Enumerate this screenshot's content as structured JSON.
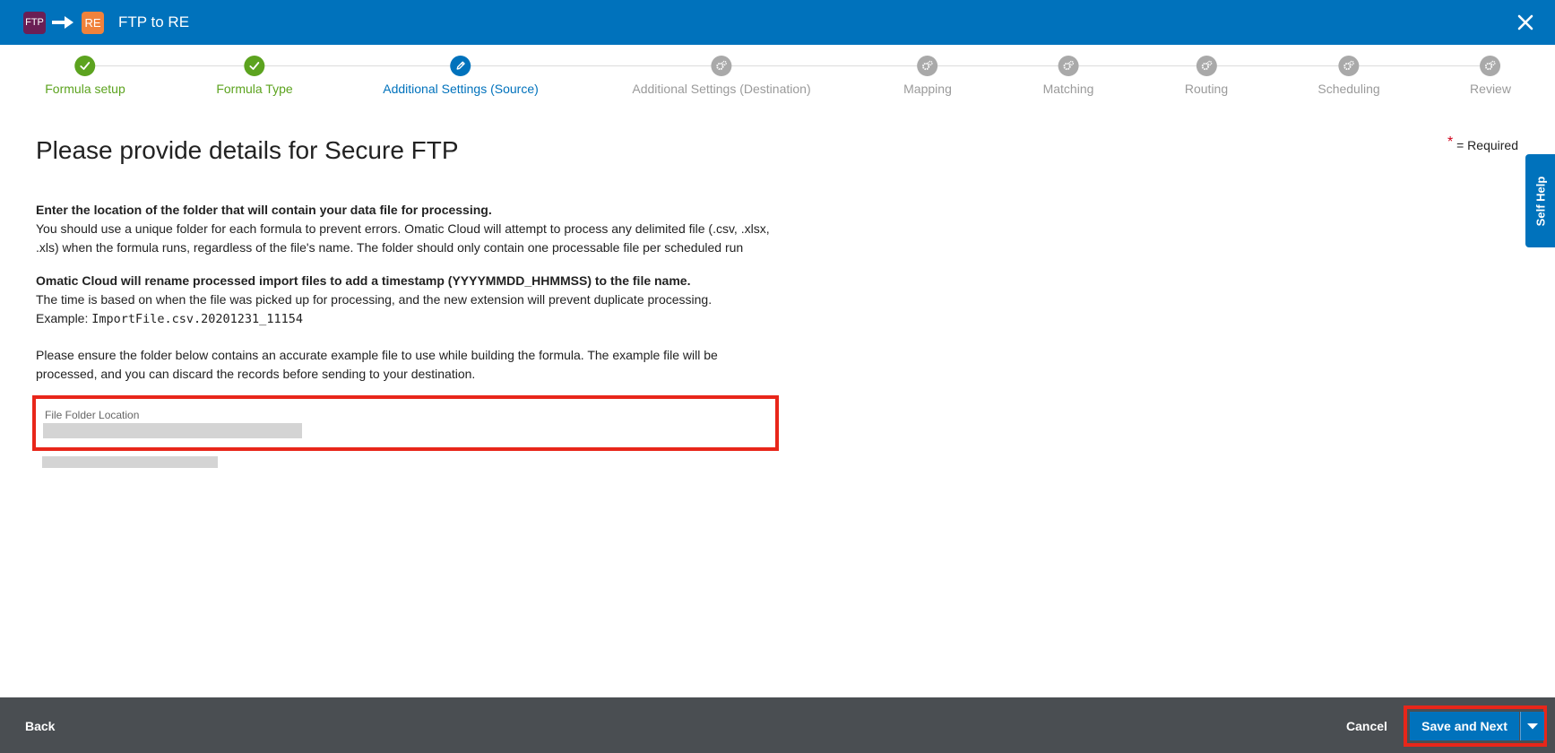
{
  "header": {
    "source_badge": "FTP",
    "dest_badge": "RE",
    "title": "FTP to RE",
    "close_icon": "close-icon"
  },
  "stepper": {
    "steps": [
      {
        "label": "Formula setup",
        "state": "done"
      },
      {
        "label": "Formula Type",
        "state": "done"
      },
      {
        "label": "Additional Settings (Source)",
        "state": "active"
      },
      {
        "label": "Additional Settings (Destination)",
        "state": "todo"
      },
      {
        "label": "Mapping",
        "state": "todo"
      },
      {
        "label": "Matching",
        "state": "todo"
      },
      {
        "label": "Routing",
        "state": "todo"
      },
      {
        "label": "Scheduling",
        "state": "todo"
      },
      {
        "label": "Review",
        "state": "todo"
      }
    ]
  },
  "main": {
    "heading": "Please provide details for Secure FTP",
    "required_marker": "*",
    "required_text": "= Required",
    "para1_bold": "Enter the location of the folder that will contain your data file for processing.",
    "para1_text": "You should use a unique folder for each formula to prevent errors. Omatic Cloud will attempt to process any delimited file (.csv, .xlsx, .xls) when the formula runs, regardless of the file's name. The folder should only contain one processable file per scheduled run",
    "para2_bold": "Omatic Cloud will rename processed import files to add a timestamp (YYYYMMDD_HHMMSS) to the file name.",
    "para2_text": "The time is based on when the file was picked up for processing, and the new extension will prevent duplicate processing.",
    "para2_example_label": "Example:",
    "para2_example_code": "ImportFile.csv.20201231_11154",
    "para3_text": "Please ensure the folder below contains an accurate example file to use while building the formula. The example file will be processed, and you can discard the records before sending to your destination.",
    "field_label": "File Folder Location"
  },
  "self_help": {
    "label": "Self Help"
  },
  "footer": {
    "back_label": "Back",
    "cancel_label": "Cancel",
    "save_label": "Save and Next"
  },
  "colors": {
    "brand_blue": "#0072bc",
    "done_green": "#5ca31f",
    "todo_gray": "#a9a9a9",
    "highlight_red": "#e8261a",
    "footer_bg": "#4a4e52"
  }
}
